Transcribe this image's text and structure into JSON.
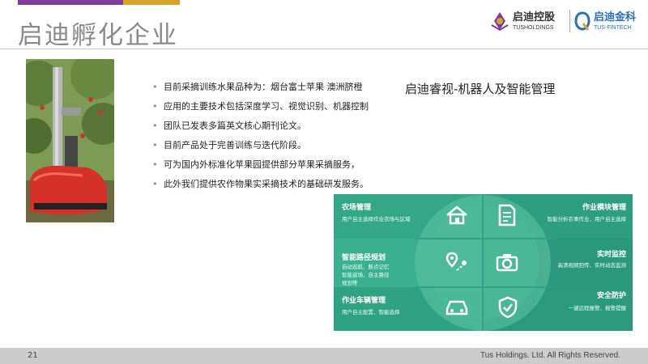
{
  "slide": {
    "title": "启迪孵化企业",
    "headline": "启迪睿视-机器人及智能管理",
    "page_number": "21",
    "copyright": "Tus Holdings. Ltd. All Rights Reserved."
  },
  "logos": {
    "tusholdings": {
      "cn": "启迪控股",
      "en": "TUSHOLDINGS"
    },
    "tusfintech": {
      "cn": "启迪金科",
      "en": "TUS-FINTECH"
    }
  },
  "bullets": [
    "目前采摘训练水果品种为：烟台富士苹果 澳洲脐橙",
    "应用的主要技术包括深度学习、视觉识别、机器控制",
    "团队已发表多篇英文核心期刊论文。",
    "目前产品处于完善训练与迭代阶段。",
    "可为国内外标准化苹果园提供部分苹果采摘服务，",
    "此外我们提供农作物果实采摘技术的基础研发服务。"
  ],
  "features": {
    "farm": {
      "title": "农场管理",
      "desc": "用户自主选择作业农场与区域",
      "icon": "house-icon"
    },
    "module": {
      "title": "作业模块管理",
      "desc": "智能分析农事作业、用户自主选择",
      "icon": "document-icon"
    },
    "path": {
      "title": "智能路径规划",
      "desc1": "自动巡航、断点记忆",
      "desc2": "智能返场、自主路径",
      "desc3": "规划等",
      "icon": "route-icon"
    },
    "monitor": {
      "title": "实时监控",
      "desc": "高清视频回传、实时动态监测",
      "icon": "camera-icon"
    },
    "vehicle": {
      "title": "作业车辆管理",
      "desc": "用户自主配置、智能选择",
      "icon": "car-icon"
    },
    "safety": {
      "title": "安全防护",
      "desc": "一键远程报警、报警提醒",
      "icon": "shield-check-icon"
    }
  },
  "colors": {
    "purple": "#7b3f98",
    "gold": "#d9a32b",
    "teal_dark": "#2fa282",
    "teal_mid": "#3fb393",
    "teal_light": "#5fc6a6"
  }
}
